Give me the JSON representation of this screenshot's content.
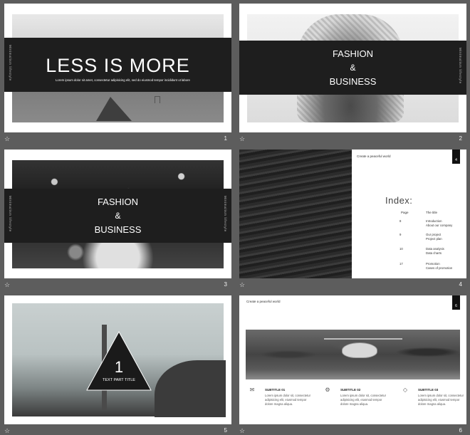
{
  "slides": [
    {
      "number": "1",
      "title": "LESS IS MORE",
      "subtitle": "Lorem ipsum dolor sit amet, consectetur adipisicing elit, sed do eiusmod tempor incididunt ut labore et dolore magna aliqua.",
      "vertical": "Minimalism lifestyle"
    },
    {
      "number": "2",
      "line1": "FASHION",
      "line2": "&",
      "line3": "BUSINESS",
      "vertical": "Minimalism lifestyle"
    },
    {
      "number": "3",
      "line1": "FASHION",
      "line2": "&",
      "line3": "BUSINESS",
      "vertical": "Minimalism lifestyle"
    },
    {
      "number": "4",
      "tag": "Create a peaceful world",
      "page_badge": "4",
      "title": "Index:",
      "col_page": "Page",
      "col_title": "The title",
      "rows": [
        {
          "page": "8",
          "title": "Introduction",
          "sub": "About our company"
        },
        {
          "page": "9",
          "title": "Our project",
          "sub": "Project plan"
        },
        {
          "page": "10",
          "title": "Data analysis",
          "sub": "Data charts"
        },
        {
          "page": "17",
          "title": "Promotion",
          "sub": "Cases of promotion"
        }
      ]
    },
    {
      "number": "5",
      "big_num": "1",
      "part_title": "TEXT PART TITLE"
    },
    {
      "number": "6",
      "tag": "Create a peaceful world",
      "page_badge": "6",
      "columns": [
        {
          "icon": "✉",
          "title": "SUBTITLE 01",
          "body": "Lorem ipsum dolor sit, consectetur adipisicing elit, eiusmod tempor dolore magna aliqua."
        },
        {
          "icon": "⚙",
          "title": "SUBTITLE 02",
          "body": "Lorem ipsum dolor sit, consectetur adipisicing elit, eiusmod tempor dolore magna aliqua."
        },
        {
          "icon": "◇",
          "title": "SUBTITLE 03",
          "body": "Lorem ipsum dolor sit, consectetur adipisicing elit, eiusmod tempor dolore magna aliqua."
        }
      ]
    }
  ],
  "star_glyph": "☆"
}
